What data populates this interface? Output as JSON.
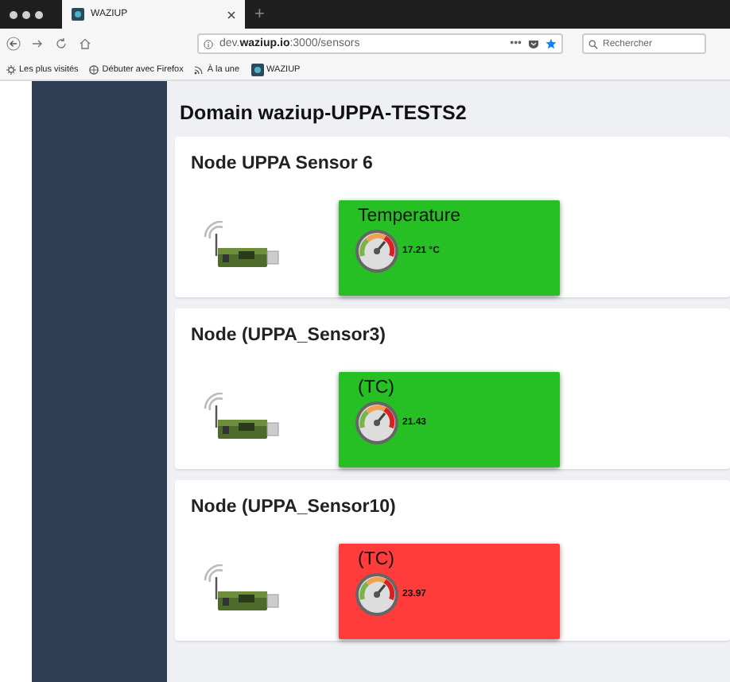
{
  "browser": {
    "tab": {
      "title": "WAZIUP",
      "selected": true
    },
    "new_tab": "+",
    "address": "dev.**waziup.io**:3000/sensors",
    "page_actions": "•••",
    "search": {
      "placeholder": "Rechercher"
    },
    "bookmarks": [
      "Les plus visités",
      "Débuter avec Firefox",
      "À la une",
      "WAZIUP"
    ]
  },
  "page": {
    "title": "Domain waziup-UPPA-TESTS2",
    "nodes": [
      {
        "name": "Node UPPA Sensor 6",
        "sensors": [
          {
            "label": "Temperature",
            "value": "17.21 °C",
            "color": "#27c024"
          }
        ]
      },
      {
        "name": "Node (UPPA_Sensor3)",
        "sensors": [
          {
            "label": "(TC)",
            "value": "21.43",
            "color": "#27c024"
          }
        ]
      },
      {
        "name": "Node (UPPA_Sensor10)",
        "sensors": [
          {
            "label": "(TC)",
            "value": "23.97",
            "color": "#ff3b3b"
          }
        ]
      }
    ]
  }
}
